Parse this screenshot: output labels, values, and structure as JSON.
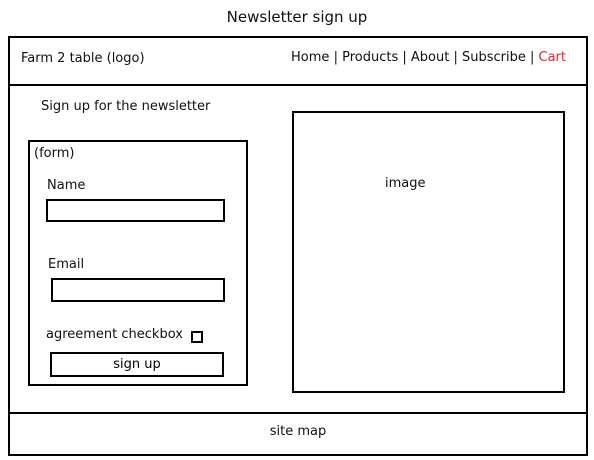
{
  "page": {
    "title": "Newsletter sign up"
  },
  "header": {
    "logo": "Farm 2 table (logo)",
    "nav": {
      "items": [
        "Home",
        "Products",
        "About",
        "Subscribe",
        "Cart"
      ],
      "separator": "|"
    },
    "colors": {
      "cart": "#e8232a"
    }
  },
  "main": {
    "heading": "Sign up for the newsletter",
    "form": {
      "label": "(form)",
      "name_label": "Name",
      "name_value": "",
      "email_label": "Email",
      "email_value": "",
      "agreement_label": "agreement checkbox",
      "agreement_checked": false,
      "submit_label": "sign up"
    },
    "image_placeholder": "image"
  },
  "footer": {
    "sitemap": "site map"
  }
}
